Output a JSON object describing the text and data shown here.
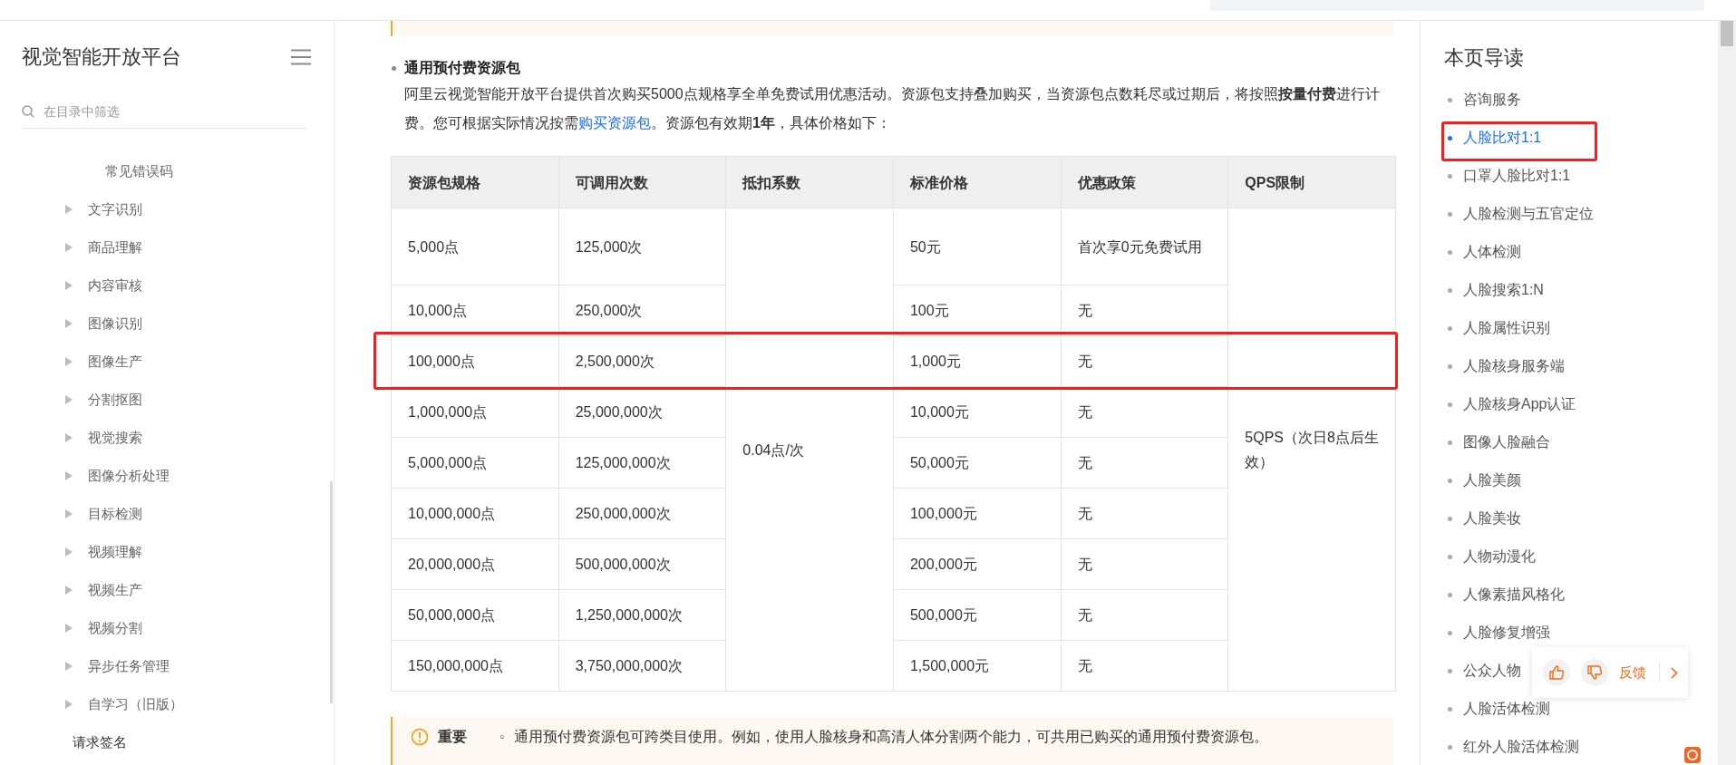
{
  "sidebar": {
    "title": "视觉智能开放平台",
    "search": {
      "placeholder": "在目录中筛选"
    },
    "items": [
      {
        "label": "常见错误码",
        "kind": "leaf"
      },
      {
        "label": "文字识别",
        "kind": "group",
        "expanded": false
      },
      {
        "label": "商品理解",
        "kind": "group",
        "expanded": false
      },
      {
        "label": "内容审核",
        "kind": "group",
        "expanded": false
      },
      {
        "label": "图像识别",
        "kind": "group",
        "expanded": false
      },
      {
        "label": "图像生产",
        "kind": "group",
        "expanded": false
      },
      {
        "label": "分割抠图",
        "kind": "group",
        "expanded": false
      },
      {
        "label": "视觉搜索",
        "kind": "group",
        "expanded": false
      },
      {
        "label": "图像分析处理",
        "kind": "group",
        "expanded": false
      },
      {
        "label": "目标检测",
        "kind": "group",
        "expanded": false
      },
      {
        "label": "视频理解",
        "kind": "group",
        "expanded": false
      },
      {
        "label": "视频生产",
        "kind": "group",
        "expanded": false
      },
      {
        "label": "视频分割",
        "kind": "group",
        "expanded": false
      },
      {
        "label": "异步任务管理",
        "kind": "group",
        "expanded": false
      },
      {
        "label": "自学习（旧版）",
        "kind": "group",
        "expanded": false
      },
      {
        "label": "请求签名",
        "kind": "top"
      }
    ]
  },
  "content": {
    "heading": "通用预付费资源包",
    "paragraph": "阿里云视觉智能开放平台提供首次购买5000点规格享全单免费试用优惠活动。资源包支持叠加购买，当资源包点数耗尽或过期后，将按照**按量付费**进行计费。您可根据实际情况按需",
    "link": "购买资源包",
    "paragraph_end": "。资源包有效期**1年**，具体价格如下：",
    "table": {
      "columns": [
        "资源包规格",
        "可调用次数",
        "抵扣系数",
        "标准价格",
        "优惠政策",
        "QPS限制"
      ],
      "deduction": "0.04点/次",
      "qps": "5QPS（次日8点后生效）",
      "rows": [
        {
          "spec": "5,000点",
          "calls": "125,000次",
          "price": "50元",
          "policy": "首次享0元免费试用",
          "highlighted": false
        },
        {
          "spec": "10,000点",
          "calls": "250,000次",
          "price": "100元",
          "policy": "无",
          "highlighted": false
        },
        {
          "spec": "100,000点",
          "calls": "2,500,000次",
          "price": "1,000元",
          "policy": "无",
          "highlighted": true
        },
        {
          "spec": "1,000,000点",
          "calls": "25,000,000次",
          "price": "10,000元",
          "policy": "无",
          "highlighted": false
        },
        {
          "spec": "5,000,000点",
          "calls": "125,000,000次",
          "price": "50,000元",
          "policy": "无",
          "highlighted": false
        },
        {
          "spec": "10,000,000点",
          "calls": "250,000,000次",
          "price": "100,000元",
          "policy": "无",
          "highlighted": false
        },
        {
          "spec": "20,000,000点",
          "calls": "500,000,000次",
          "price": "200,000元",
          "policy": "无",
          "highlighted": false
        },
        {
          "spec": "50,000,000点",
          "calls": "1,250,000,000次",
          "price": "500,000元",
          "policy": "无",
          "highlighted": false
        },
        {
          "spec": "150,000,000点",
          "calls": "3,750,000,000次",
          "price": "1,500,000元",
          "policy": "无",
          "highlighted": false
        }
      ]
    },
    "note": {
      "label": "重要",
      "bullet": "◦",
      "text": "通用预付费资源包可跨类目使用。例如，使用人脸核身和高清人体分割两个能力，可共用已购买的通用预付费资源包。"
    }
  },
  "toc": {
    "title": "本页导读",
    "items": [
      {
        "label": "咨询服务",
        "selected": false,
        "highlighted": false
      },
      {
        "label": "人脸比对1:1",
        "selected": true,
        "highlighted": true
      },
      {
        "label": "口罩人脸比对1:1",
        "selected": false,
        "highlighted": false
      },
      {
        "label": "人脸检测与五官定位",
        "selected": false,
        "highlighted": false
      },
      {
        "label": "人体检测",
        "selected": false,
        "highlighted": false
      },
      {
        "label": "人脸搜索1:N",
        "selected": false,
        "highlighted": false
      },
      {
        "label": "人脸属性识别",
        "selected": false,
        "highlighted": false
      },
      {
        "label": "人脸核身服务端",
        "selected": false,
        "highlighted": false
      },
      {
        "label": "人脸核身App认证",
        "selected": false,
        "highlighted": false
      },
      {
        "label": "图像人脸融合",
        "selected": false,
        "highlighted": false
      },
      {
        "label": "人脸美颜",
        "selected": false,
        "highlighted": false
      },
      {
        "label": "人脸美妆",
        "selected": false,
        "highlighted": false
      },
      {
        "label": "人物动漫化",
        "selected": false,
        "highlighted": false
      },
      {
        "label": "人像素描风格化",
        "selected": false,
        "highlighted": false
      },
      {
        "label": "人脸修复增强",
        "selected": false,
        "highlighted": false
      },
      {
        "label": "公众人物",
        "selected": false,
        "highlighted": false
      },
      {
        "label": "人脸活体检测",
        "selected": false,
        "highlighted": false
      },
      {
        "label": "红外人脸活体检测",
        "selected": false,
        "highlighted": false
      }
    ]
  },
  "feedback": {
    "label": "反馈"
  }
}
